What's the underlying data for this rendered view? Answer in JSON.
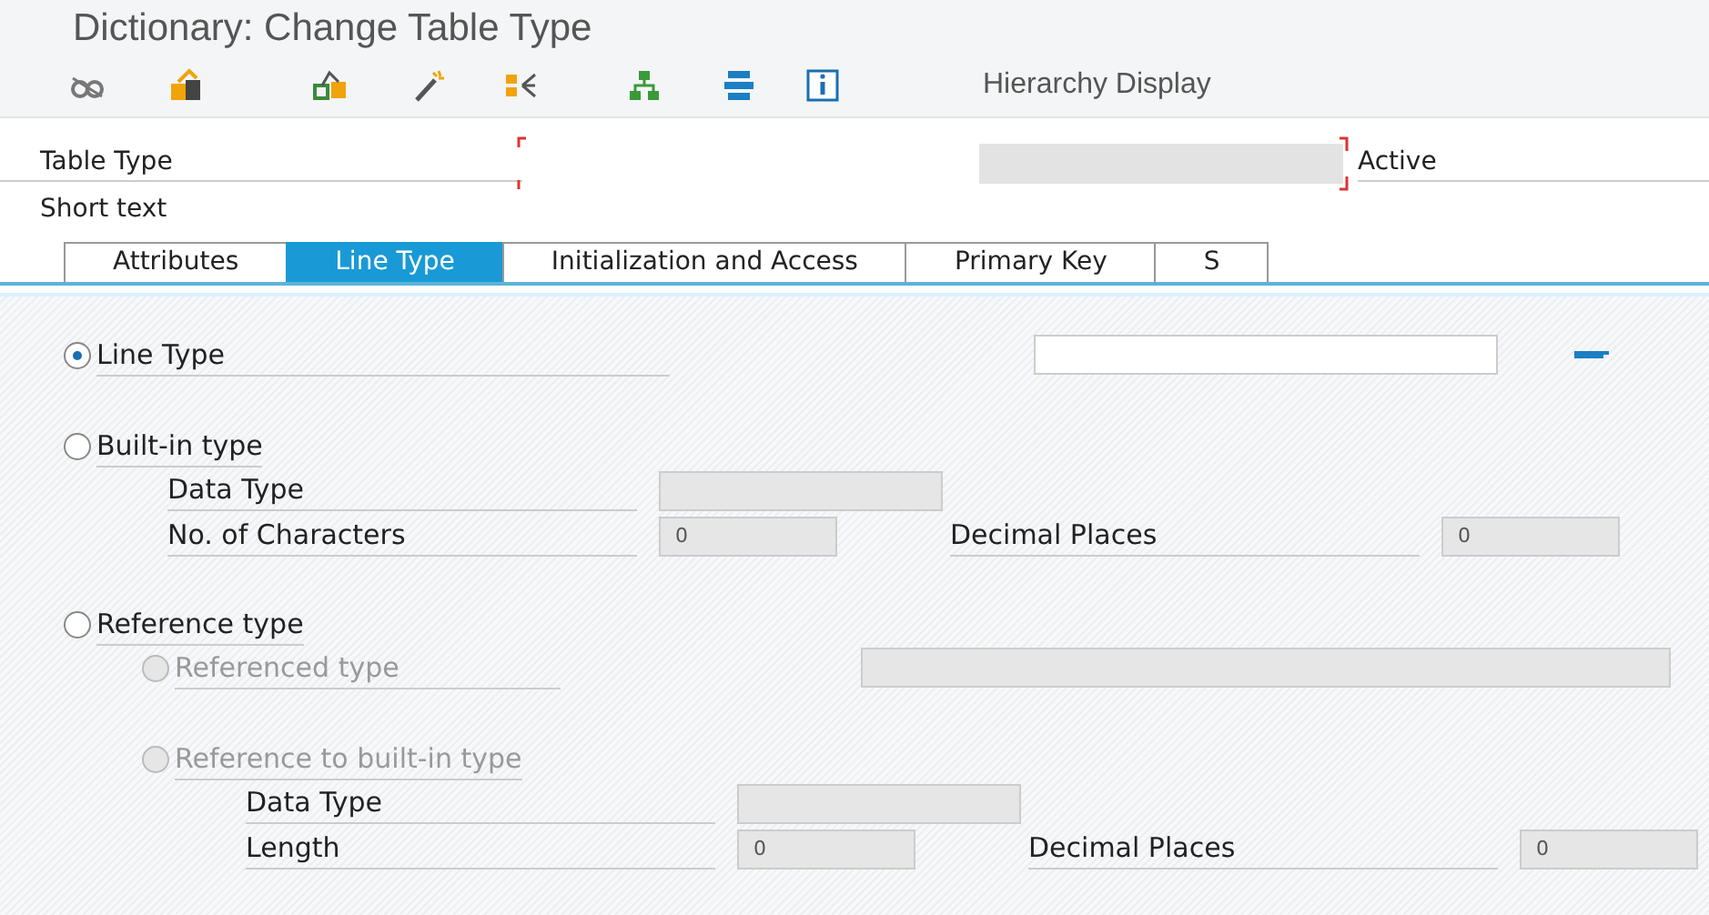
{
  "window": {
    "title": "Dictionary: Change Table Type"
  },
  "toolbar": {
    "button": "Hierarchy Display"
  },
  "header": {
    "table_type": {
      "label": "Table Type",
      "status": "Active"
    },
    "short_text": {
      "label": "Short text"
    }
  },
  "tabs": [
    {
      "label": "Attributes",
      "selected": false
    },
    {
      "label": "Line Type",
      "selected": true
    },
    {
      "label": "Initialization and Access",
      "selected": false
    },
    {
      "label": "Primary Key",
      "selected": false
    },
    {
      "label": "S",
      "selected": false
    }
  ],
  "options": [
    {
      "label": "Line Type",
      "selected": true,
      "disabled": false,
      "field": true
    },
    {
      "label": "Built-in type",
      "selected": false,
      "disabled": false,
      "rows": [
        {
          "fields": [
            {
              "label": "Data Type"
            }
          ]
        },
        {
          "fields": [
            {
              "label": "No. of Characters",
              "value": "0"
            },
            {
              "label": "Decimal Places",
              "value": "0"
            }
          ]
        }
      ]
    },
    {
      "label": "Reference type",
      "selected": false,
      "disabled": false,
      "children": [
        {
          "label": "Referenced type",
          "selected": false,
          "disabled": true,
          "field": true
        },
        {
          "label": "Reference to built-in type",
          "selected": false,
          "disabled": true,
          "rows": [
            {
              "fields": [
                {
                  "label": "Data Type"
                }
              ]
            },
            {
              "fields": [
                {
                  "label": "Length",
                  "value": "0"
                },
                {
                  "label": "Decimal Places",
                  "value": "0"
                }
              ]
            }
          ]
        }
      ]
    }
  ]
}
